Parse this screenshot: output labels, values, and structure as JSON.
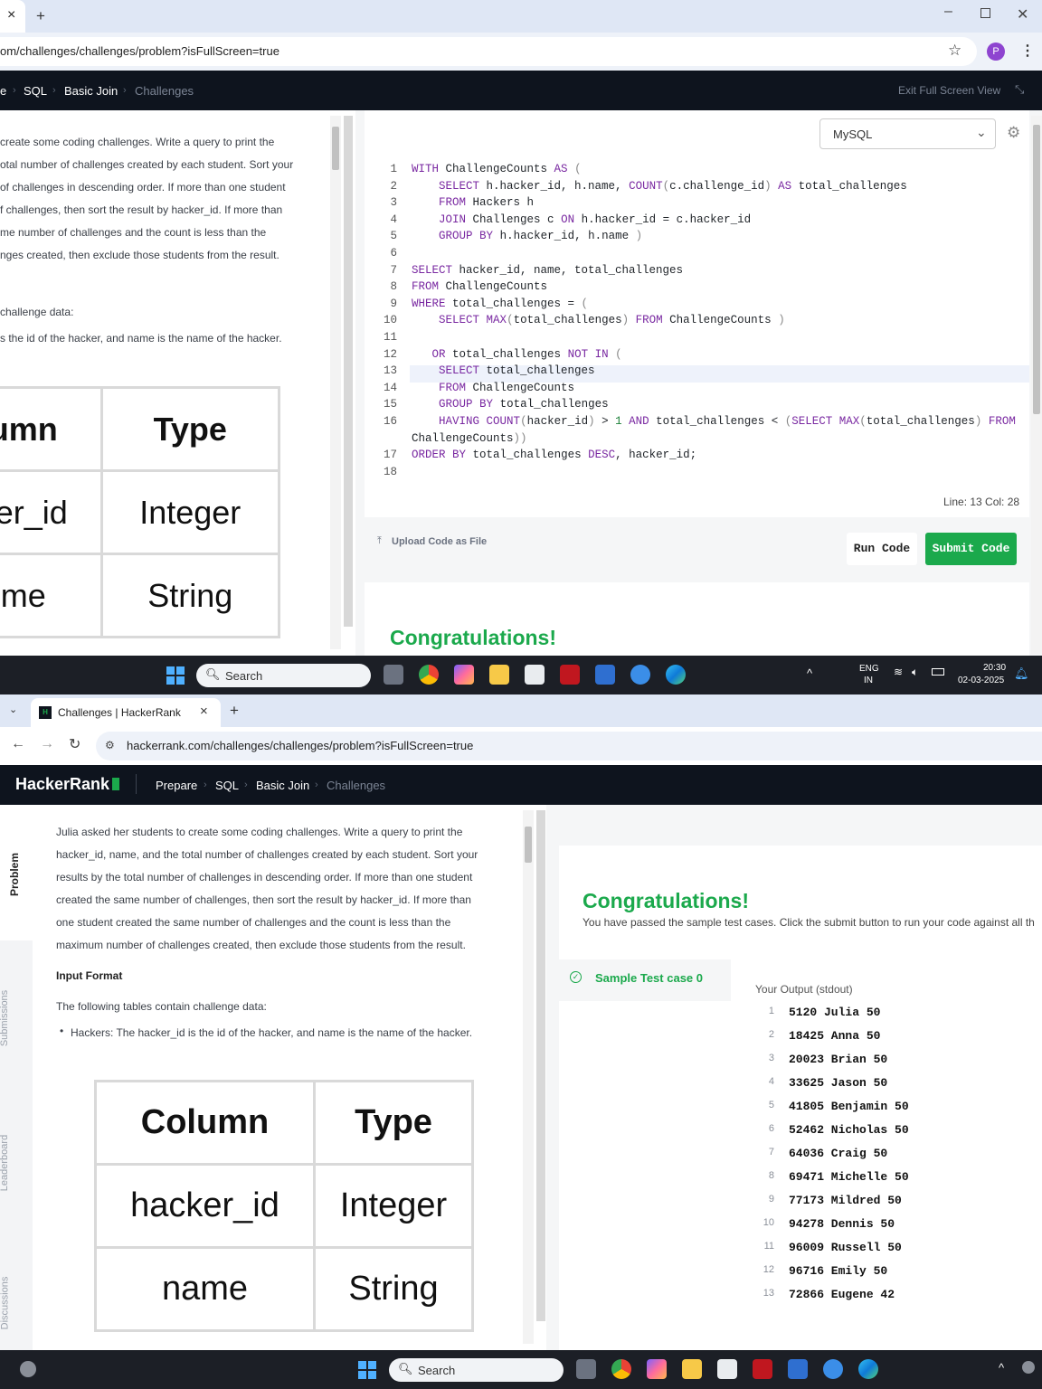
{
  "top": {
    "tab_close": "×",
    "tab_new": "+",
    "url": "om/challenges/challenges/problem?isFullScreen=true",
    "profile": "P",
    "breadcrumb": [
      "e",
      "SQL",
      "Basic Join",
      "Challenges"
    ],
    "exit_full_screen": "Exit Full Screen View",
    "problem_lines": [
      "create some coding challenges. Write a query to print the",
      "otal number of challenges created by each student. Sort your",
      "of challenges in descending order. If more than one student",
      "f challenges, then sort the result by hacker_id. If more than",
      "me number of challenges and the count is less than the",
      "nges created, then exclude those students from the result."
    ],
    "challenge_data": "challenge data:",
    "hackers_desc": "s the id of the hacker, and name is the name of the hacker.",
    "table": {
      "h1": "umn",
      "h2": "Type",
      "r1c1": "ker_id",
      "r1c2": "Integer",
      "r2c1": "me",
      "r2c2": "String"
    },
    "language": "MySQL",
    "code": [
      {
        "n": "1",
        "t": "WITH ChallengeCounts AS ("
      },
      {
        "n": "2",
        "t": "    SELECT h.hacker_id, h.name, COUNT(c.challenge_id) AS total_challenges"
      },
      {
        "n": "3",
        "t": "    FROM Hackers h"
      },
      {
        "n": "4",
        "t": "    JOIN Challenges c ON h.hacker_id = c.hacker_id"
      },
      {
        "n": "5",
        "t": "    GROUP BY h.hacker_id, h.name )"
      },
      {
        "n": "6",
        "t": ""
      },
      {
        "n": "7",
        "t": "SELECT hacker_id, name, total_challenges"
      },
      {
        "n": "8",
        "t": "FROM ChallengeCounts"
      },
      {
        "n": "9",
        "t": "WHERE total_challenges = ("
      },
      {
        "n": "10",
        "t": "    SELECT MAX(total_challenges) FROM ChallengeCounts )"
      },
      {
        "n": "11",
        "t": ""
      },
      {
        "n": "12",
        "t": "   OR total_challenges NOT IN ("
      },
      {
        "n": "13",
        "t": "    SELECT total_challenges"
      },
      {
        "n": "14",
        "t": "    FROM ChallengeCounts"
      },
      {
        "n": "15",
        "t": "    GROUP BY total_challenges"
      },
      {
        "n": "16",
        "t": "    HAVING COUNT(hacker_id) > 1 AND total_challenges < (SELECT MAX(total_challenges) FROM"
      },
      {
        "n": "",
        "t": "ChallengeCounts))"
      },
      {
        "n": "17",
        "t": "ORDER BY total_challenges DESC, hacker_id;"
      },
      {
        "n": "18",
        "t": ""
      }
    ],
    "cursor_pos": "Line: 13 Col: 28",
    "upload": "Upload Code as File",
    "run": "Run Code",
    "submit": "Submit Code",
    "congrats": "Congratulations!"
  },
  "taskbar1": {
    "search": "Search",
    "lang1": "ENG",
    "lang2": "IN",
    "time": "20:30",
    "date": "02-03-2025"
  },
  "bottom": {
    "tab_title": "Challenges | HackerRank",
    "tab_close": "×",
    "tab_new": "+",
    "url": "hackerrank.com/challenges/challenges/problem?isFullScreen=true",
    "logo": "HackerRank",
    "breadcrumb": [
      "Prepare",
      "SQL",
      "Basic Join",
      "Challenges"
    ],
    "side_tabs": [
      "Problem",
      "Submissions",
      "Leaderboard",
      "Discussions"
    ],
    "problem_lines": [
      "Julia asked her students to create some coding challenges. Write a query to print the",
      "hacker_id, name, and the total number of challenges created by each student. Sort your",
      "results by the total number of challenges in descending order. If more than one student",
      "created the same number of challenges, then sort the result by hacker_id. If more than",
      "one student created the same number of challenges and the count is less than the",
      "maximum number of challenges created, then exclude those students from the result."
    ],
    "input_format": "Input Format",
    "tables_intro": "The following tables contain challenge data:",
    "hackers_bullet": "Hackers: The hacker_id is the id of the hacker, and name is the name of the hacker.",
    "table": {
      "h1": "Column",
      "h2": "Type",
      "r1c1": "hacker_id",
      "r1c2": "Integer",
      "r2c1": "name",
      "r2c2": "String"
    },
    "congrats": "Congratulations!",
    "congrats_sub": "You have passed the sample test cases. Click the submit button to run your code against all th",
    "sample_case": "Sample Test case 0",
    "your_output": "Your Output (stdout)",
    "output": [
      {
        "n": "1",
        "v": "5120 Julia 50"
      },
      {
        "n": "2",
        "v": "18425 Anna 50"
      },
      {
        "n": "3",
        "v": "20023 Brian 50"
      },
      {
        "n": "4",
        "v": "33625 Jason 50"
      },
      {
        "n": "5",
        "v": "41805 Benjamin 50"
      },
      {
        "n": "6",
        "v": "52462 Nicholas 50"
      },
      {
        "n": "7",
        "v": "64036 Craig 50"
      },
      {
        "n": "8",
        "v": "69471 Michelle 50"
      },
      {
        "n": "9",
        "v": "77173 Mildred 50"
      },
      {
        "n": "10",
        "v": "94278 Dennis 50"
      },
      {
        "n": "11",
        "v": "96009 Russell 50"
      },
      {
        "n": "12",
        "v": "96716 Emily 50"
      },
      {
        "n": "13",
        "v": "72866 Eugene 42"
      }
    ]
  },
  "taskbar2": {
    "search": "Search"
  },
  "colors": {
    "nav": "#0e141e",
    "accent_green": "#1ba94c",
    "keyword": "#7928a1"
  }
}
